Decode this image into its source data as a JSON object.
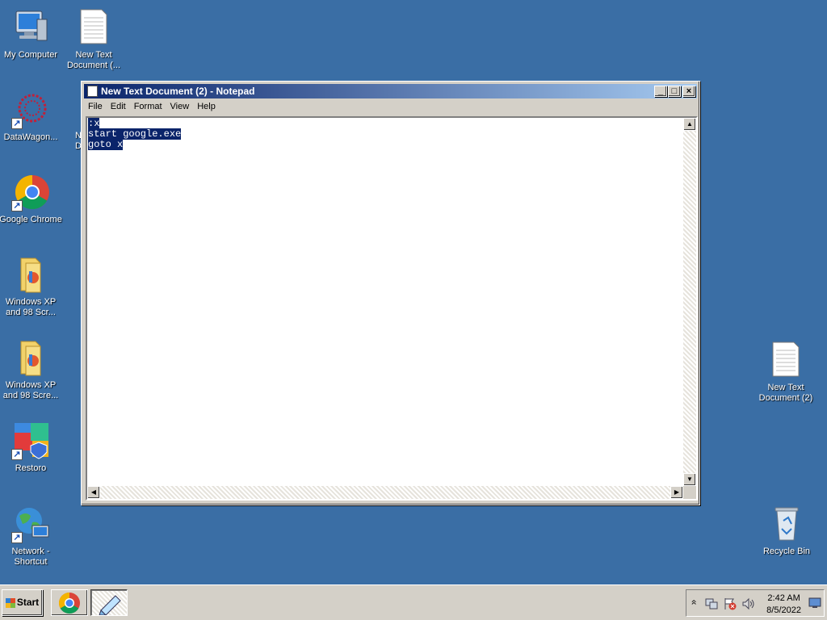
{
  "desktop": {
    "icons": [
      {
        "label": "My Computer"
      },
      {
        "label": "New Text Document (..."
      },
      {
        "label": "DataWagon..."
      },
      {
        "label": "Google Chrome"
      },
      {
        "label": "Windows XP and 98 Scr..."
      },
      {
        "label": "Windows XP and 98 Scre..."
      },
      {
        "label": "Restoro"
      },
      {
        "label": "Network - Shortcut"
      },
      {
        "label": "New Text Document (2)"
      },
      {
        "label": "Recycle Bin"
      }
    ],
    "hidden_icon_partial": "N\nD"
  },
  "notepad": {
    "title": "New Text Document (2) - Notepad",
    "menu": [
      "File",
      "Edit",
      "Format",
      "View",
      "Help"
    ],
    "lines": [
      ":x",
      "start google.exe",
      "goto x"
    ]
  },
  "taskbar": {
    "start_label": "Start",
    "tray": {
      "time": "2:42 AM",
      "date": "8/5/2022",
      "expand_glyph": "»"
    }
  }
}
